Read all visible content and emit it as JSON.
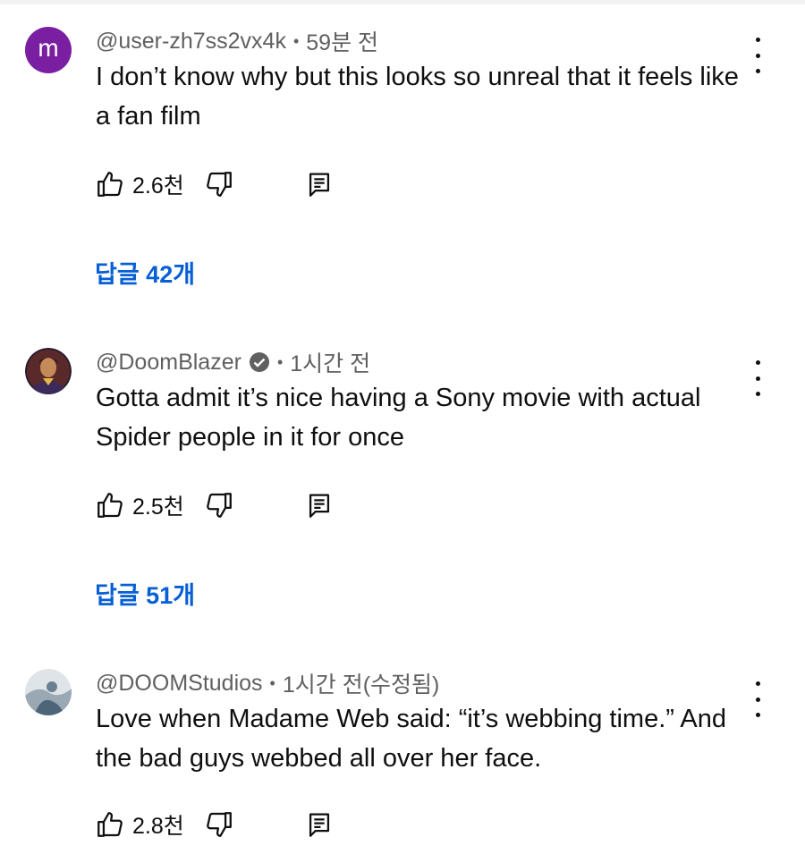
{
  "comments": [
    {
      "author": "@user-zh7ss2vx4k",
      "avatar_letter": "m",
      "time": "59분 전",
      "verified": false,
      "text": "I don’t know why but this looks so unreal that it feels like a fan film",
      "likes": "2.6천",
      "replies_label": "답글 42개"
    },
    {
      "author": "@DoomBlazer",
      "time": "1시간 전",
      "verified": true,
      "text": "Gotta admit it’s nice having a Sony movie with actual Spider people in it for once",
      "likes": "2.5천",
      "replies_label": "답글 51개"
    },
    {
      "author": "@DOOMStudios",
      "time": "1시간 전(수정됨)",
      "verified": false,
      "text": "Love when Madame Web said: “it’s webbing time.” And the bad guys webbed all over her face.",
      "likes": "2.8천"
    }
  ],
  "separator": "•",
  "icons": {
    "like": "thumbs-up-icon",
    "dislike": "thumbs-down-icon",
    "reply": "comment-reply-icon",
    "more": "more-vert-icon",
    "verified": "verified-check-icon"
  },
  "colors": {
    "link": "#065fd4",
    "meta": "#606060",
    "text": "#0f0f0f",
    "avatar_letter_bg": "#7b1fa2"
  }
}
